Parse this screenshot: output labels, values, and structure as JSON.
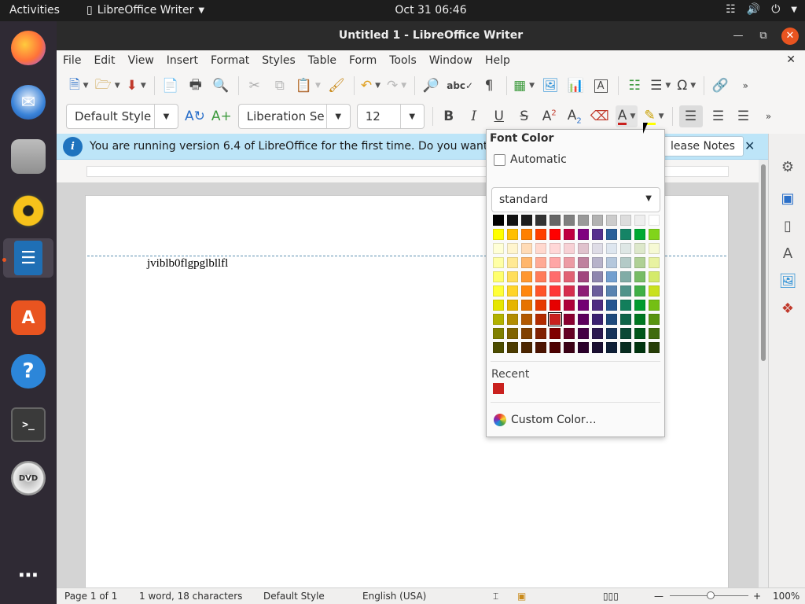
{
  "topbar": {
    "activities": "Activities",
    "app_name": "LibreOffice Writer",
    "clock": "Oct 31  06:46"
  },
  "dock": {
    "items": [
      "Firefox",
      "Thunderbird",
      "Files",
      "Rhythmbox",
      "LibreOffice Writer",
      "Ubuntu Software",
      "Help",
      "Terminal",
      "DVD",
      "Show Applications"
    ]
  },
  "window": {
    "title": "Untitled 1 - LibreOffice Writer"
  },
  "menu": [
    "File",
    "Edit",
    "View",
    "Insert",
    "Format",
    "Styles",
    "Table",
    "Form",
    "Tools",
    "Window",
    "Help"
  ],
  "formatting": {
    "paragraph_style": "Default Style",
    "font_name": "Liberation Se",
    "font_size": "12"
  },
  "infobar": {
    "message": "You are running version 6.4 of LibreOffice for the first time. Do you want to",
    "button": "lease Notes"
  },
  "document": {
    "text": "jviblb0flgpglbllfl"
  },
  "font_color_popup": {
    "title": "Font Color",
    "automatic_label": "Automatic",
    "palette": "standard",
    "recent_label": "Recent",
    "recent_colors": [
      "#c9211e"
    ],
    "custom_label": "Custom Color…",
    "selected_color": "#c9211e",
    "colors": [
      [
        "#000000",
        "#111111",
        "#1c1c1c",
        "#333333",
        "#666666",
        "#808080",
        "#999999",
        "#b2b2b2",
        "#cccccc",
        "#dddddd",
        "#eeeeee",
        "#ffffff"
      ],
      [
        "#ffff00",
        "#ffbf00",
        "#ff8000",
        "#ff4000",
        "#ff0000",
        "#bf0041",
        "#800080",
        "#55308d",
        "#2a6099",
        "#158466",
        "#00a933",
        "#81d41a"
      ],
      [
        "#ffffd7",
        "#fff5ce",
        "#ffdbb6",
        "#ffd8ce",
        "#ffd7d7",
        "#f7d1d5",
        "#e0c2cd",
        "#dedce6",
        "#dee6ef",
        "#dee7e5",
        "#dde8cb",
        "#f6f9d4"
      ],
      [
        "#ffffa6",
        "#ffe994",
        "#ffb66c",
        "#ffaa95",
        "#ffa6a6",
        "#ec9ba4",
        "#bf819e",
        "#b7b3ca",
        "#b4c7dc",
        "#b3cac7",
        "#afd095",
        "#e8f2a1"
      ],
      [
        "#ffff6d",
        "#ffde59",
        "#ff972f",
        "#ff7b59",
        "#ff6d6d",
        "#e16173",
        "#a1467e",
        "#8e86ae",
        "#729fcf",
        "#81aca6",
        "#77bc65",
        "#d4ea6b"
      ],
      [
        "#ffff38",
        "#ffd428",
        "#ff860d",
        "#ff5429",
        "#ff3838",
        "#d62e4e",
        "#8d1d75",
        "#6b5e9b",
        "#5983b0",
        "#50938a",
        "#3faf46",
        "#c9e11e"
      ],
      [
        "#e6e600",
        "#e6b500",
        "#e67300",
        "#e63900",
        "#e60000",
        "#ad003a",
        "#730073",
        "#4c2a81",
        "#245591",
        "#127e5b",
        "#009b2e",
        "#74bf13"
      ],
      [
        "#b2b200",
        "#b28c00",
        "#b25900",
        "#b22c00",
        "#c9211e",
        "#890030",
        "#5c005c",
        "#3b2171",
        "#1e4a7c",
        "#0f6449",
        "#007722",
        "#599411"
      ],
      [
        "#808000",
        "#806300",
        "#804000",
        "#802000",
        "#800000",
        "#640024",
        "#440044",
        "#2b1950",
        "#17345a",
        "#0b4836",
        "#00561a",
        "#406b0d"
      ],
      [
        "#4c4c00",
        "#4c3b00",
        "#4c2600",
        "#4c1300",
        "#4c0000",
        "#3b0015",
        "#2a002a",
        "#1a0e31",
        "#0e1f37",
        "#072b20",
        "#00340f",
        "#273e08"
      ]
    ]
  },
  "statusbar": {
    "page": "Page 1 of 1",
    "words": "1 word, 18 characters",
    "style": "Default Style",
    "language": "English (USA)",
    "zoom": "100%"
  }
}
